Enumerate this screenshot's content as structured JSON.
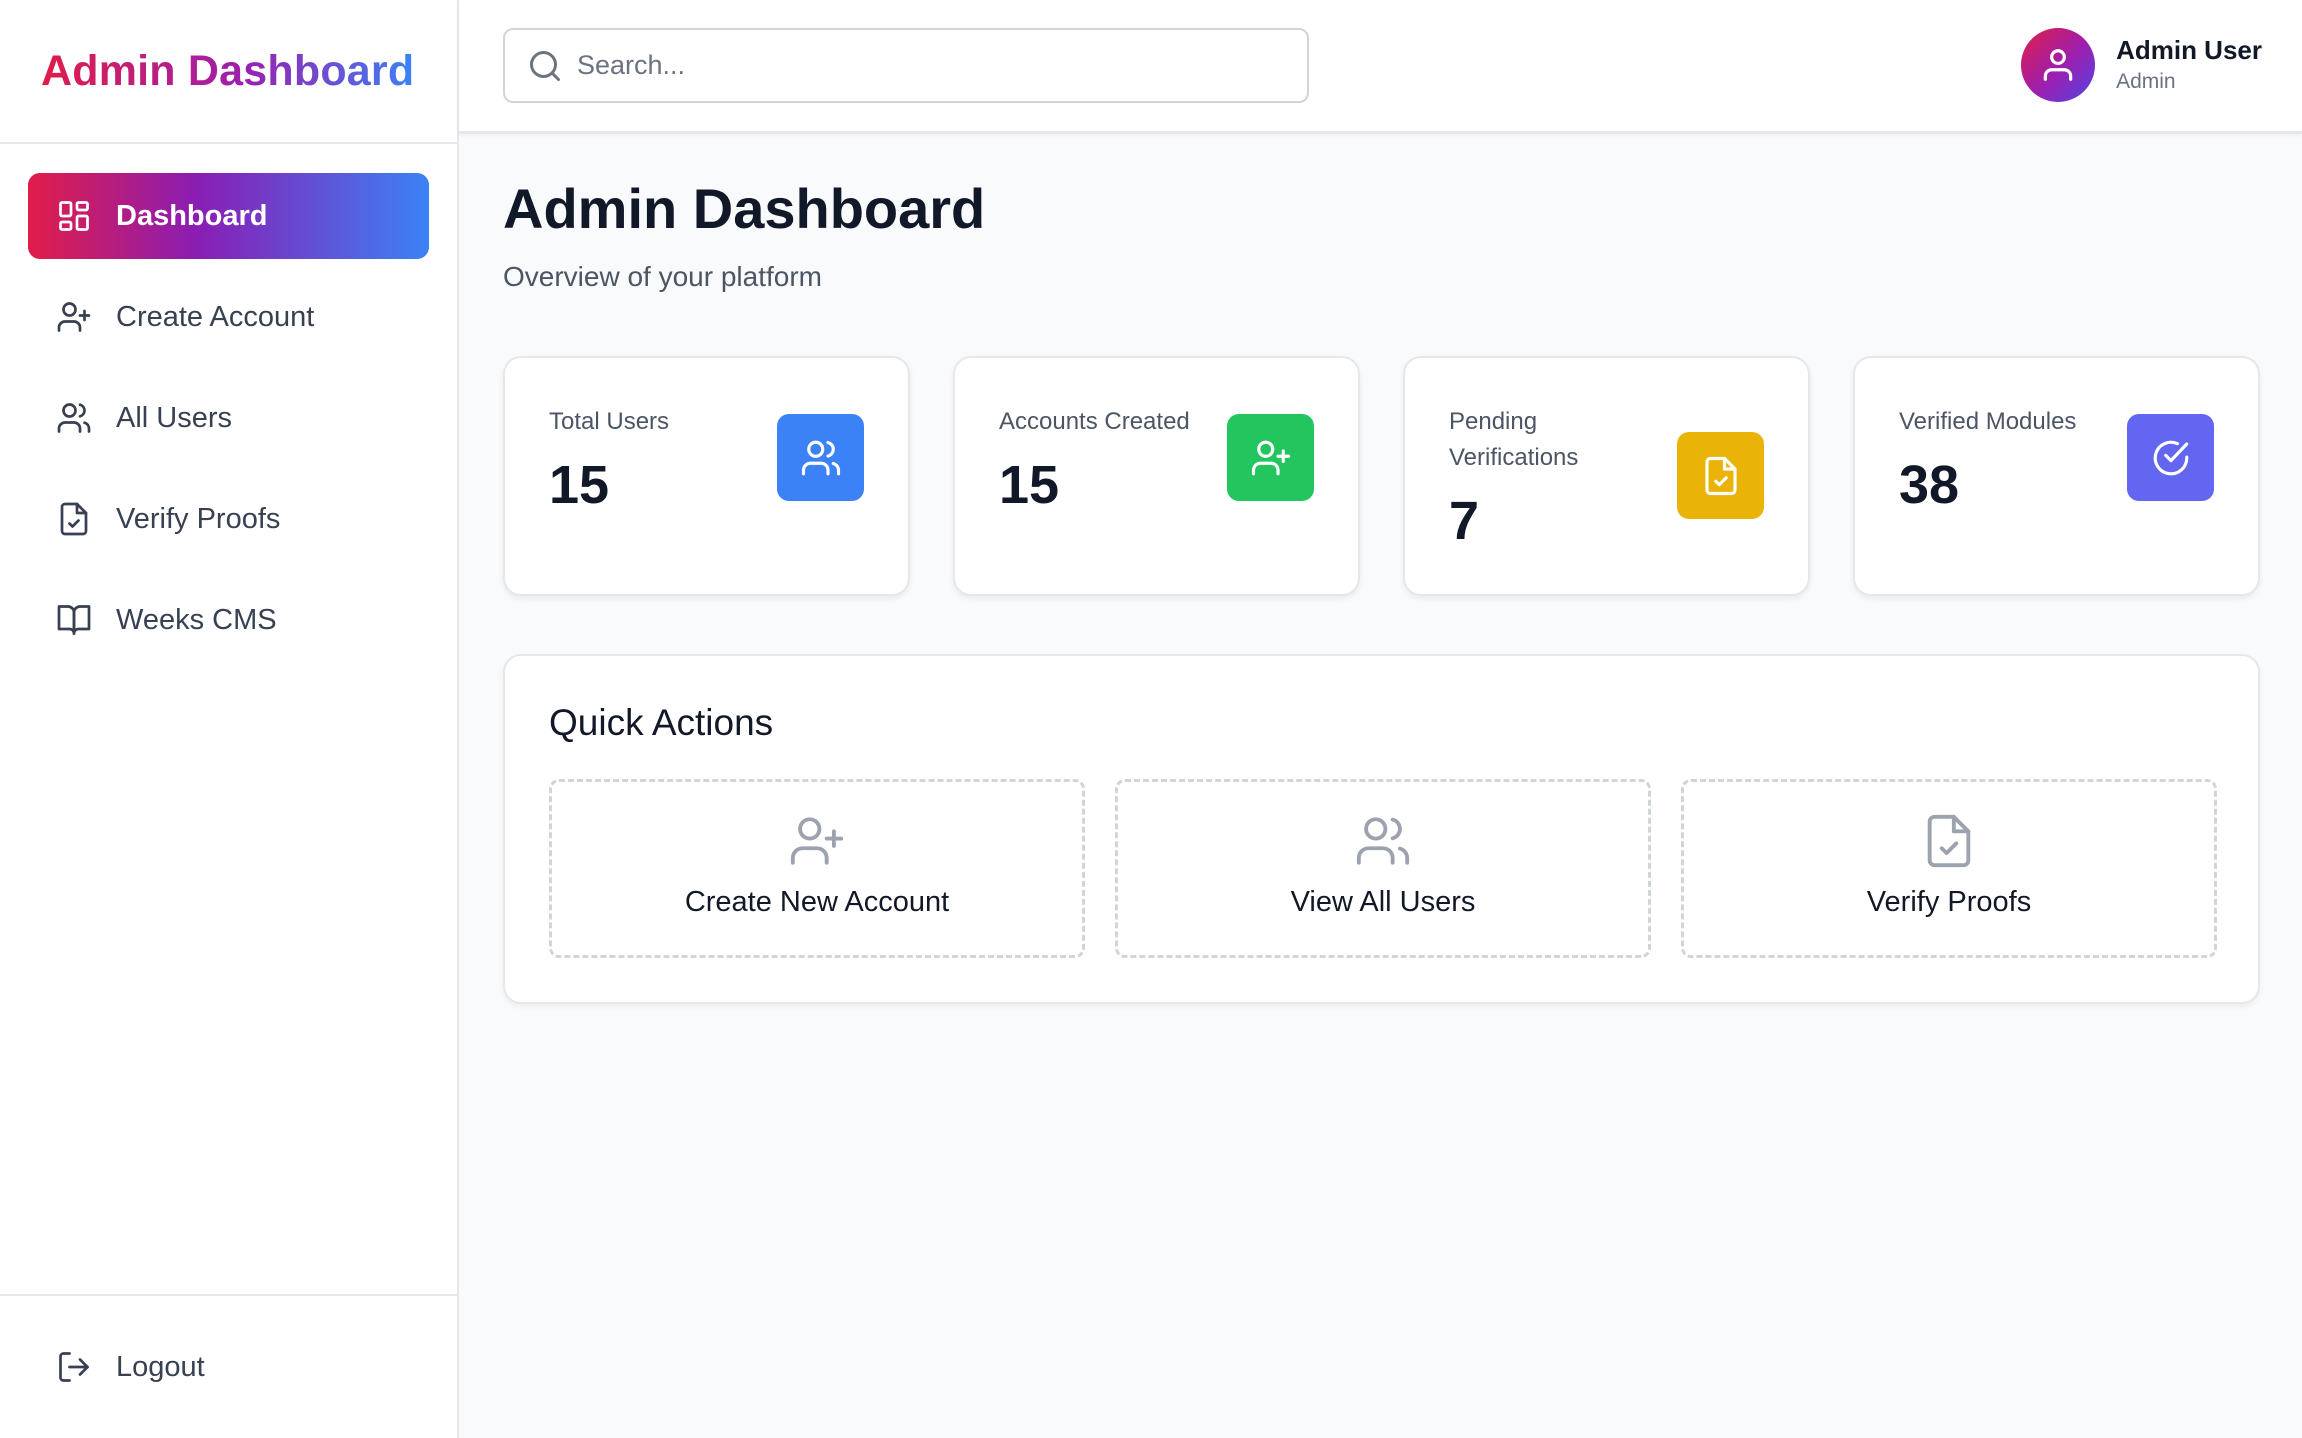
{
  "sidebar": {
    "brand": "Admin Dashboard",
    "items": [
      {
        "label": "Dashboard",
        "icon": "dashboard-grid-icon",
        "active": true
      },
      {
        "label": "Create Account",
        "icon": "user-plus-icon"
      },
      {
        "label": "All Users",
        "icon": "users-icon"
      },
      {
        "label": "Verify Proofs",
        "icon": "file-check-icon"
      },
      {
        "label": "Weeks CMS",
        "icon": "book-open-icon"
      }
    ],
    "logout": {
      "label": "Logout",
      "icon": "logout-icon"
    }
  },
  "header": {
    "search": {
      "placeholder": "Search...",
      "value": ""
    },
    "user": {
      "name": "Admin User",
      "role": "Admin"
    }
  },
  "main": {
    "title": "Admin Dashboard",
    "subtitle": "Overview of your platform",
    "stats": [
      {
        "label": "Total Users",
        "value": "15",
        "icon": "users-icon",
        "color": "#3b82f6"
      },
      {
        "label": "Accounts Created",
        "value": "15",
        "icon": "user-plus-icon",
        "color": "#22c55e"
      },
      {
        "label": "Pending Verifications",
        "value": "7",
        "icon": "file-check-icon",
        "color": "#eab308"
      },
      {
        "label": "Verified Modules",
        "value": "38",
        "icon": "check-circle-icon",
        "color": "#6366f1"
      }
    ],
    "quick_actions": {
      "title": "Quick Actions",
      "items": [
        {
          "label": "Create New Account",
          "icon": "user-plus-icon"
        },
        {
          "label": "View All Users",
          "icon": "users-icon"
        },
        {
          "label": "Verify Proofs",
          "icon": "file-check-icon"
        }
      ]
    }
  },
  "colors": {
    "brand_gradient_start": "#e11d48",
    "brand_gradient_mid": "#8a1db3",
    "brand_gradient_end": "#3b82f6"
  }
}
